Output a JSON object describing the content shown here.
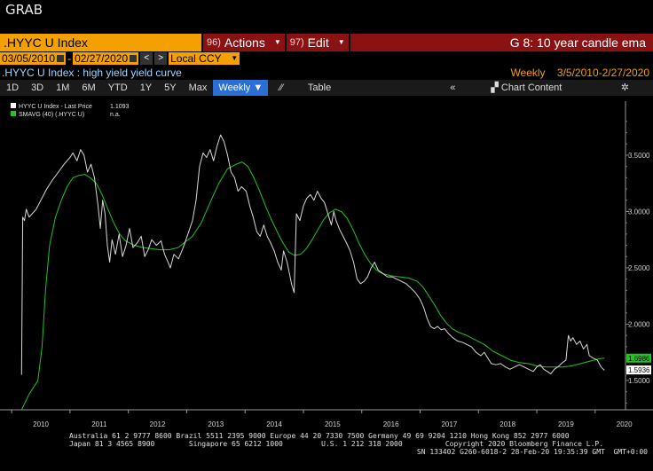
{
  "app": {
    "title": "GRAB"
  },
  "command_bar": {
    "ticker": ".HYYC U Index",
    "actions_num": "96)",
    "actions_label": "Actions",
    "edit_num": "97)",
    "edit_label": "Edit",
    "chart_title": "G 8: 10 year candle ema"
  },
  "date_range": {
    "start": "03/05/2010",
    "end": "02/27/2020",
    "currency": "Local CCY"
  },
  "header": {
    "subtitle": ".HYYC U Index : high yield yield curve",
    "periodicity": "Weekly",
    "range": "3/5/2010-2/27/2020"
  },
  "toolbar": {
    "periods": [
      "1D",
      "3D",
      "1M",
      "6M",
      "YTD",
      "1Y",
      "5Y",
      "Max"
    ],
    "frequency": "Weekly",
    "table": "Table",
    "chart_content": "Chart Content"
  },
  "legend": {
    "items": [
      {
        "label": "HYYC U Index - Last Price",
        "value": "1.1093",
        "color": "#ffffff"
      },
      {
        "label": "SMAVG (40) (.HYYC U)",
        "value": "n.a.",
        "color": "#22c322"
      }
    ]
  },
  "chart_data": {
    "type": "line",
    "x_labels": [
      "2010",
      "2011",
      "2012",
      "2013",
      "2014",
      "2015",
      "2016",
      "2017",
      "2018",
      "2019",
      "2020"
    ],
    "y_ticks": [
      "3.5000",
      "3.0000",
      "2.5000",
      "2.0000",
      "1.5000"
    ],
    "ylim": [
      1.24,
      3.98
    ],
    "grid": false,
    "series": [
      {
        "name": "HYYC U Index - Last Price",
        "color": "#d8d8d8",
        "points": [
          [
            2010.17,
            1.55
          ],
          [
            2010.19,
            2.95
          ],
          [
            2010.22,
            2.92
          ],
          [
            2010.25,
            3.02
          ],
          [
            2010.3,
            2.95
          ],
          [
            2010.35,
            2.98
          ],
          [
            2010.42,
            3.02
          ],
          [
            2010.5,
            3.1
          ],
          [
            2010.6,
            3.2
          ],
          [
            2010.7,
            3.28
          ],
          [
            2010.8,
            3.35
          ],
          [
            2010.9,
            3.42
          ],
          [
            2011.0,
            3.48
          ],
          [
            2011.05,
            3.52
          ],
          [
            2011.12,
            3.45
          ],
          [
            2011.18,
            3.55
          ],
          [
            2011.24,
            3.5
          ],
          [
            2011.3,
            3.35
          ],
          [
            2011.36,
            3.42
          ],
          [
            2011.42,
            3.3
          ],
          [
            2011.48,
            3.05
          ],
          [
            2011.52,
            2.85
          ],
          [
            2011.56,
            3.1
          ],
          [
            2011.6,
            2.98
          ],
          [
            2011.64,
            2.7
          ],
          [
            2011.68,
            2.55
          ],
          [
            2011.72,
            2.75
          ],
          [
            2011.78,
            2.62
          ],
          [
            2011.84,
            2.8
          ],
          [
            2011.9,
            2.6
          ],
          [
            2011.96,
            2.7
          ],
          [
            2012.02,
            2.85
          ],
          [
            2012.08,
            2.68
          ],
          [
            2012.15,
            2.72
          ],
          [
            2012.22,
            2.78
          ],
          [
            2012.28,
            2.6
          ],
          [
            2012.34,
            2.66
          ],
          [
            2012.4,
            2.75
          ],
          [
            2012.48,
            2.7
          ],
          [
            2012.56,
            2.74
          ],
          [
            2012.62,
            2.62
          ],
          [
            2012.68,
            2.55
          ],
          [
            2012.72,
            2.5
          ],
          [
            2012.78,
            2.62
          ],
          [
            2012.86,
            2.58
          ],
          [
            2012.94,
            2.68
          ],
          [
            2013.02,
            2.8
          ],
          [
            2013.1,
            2.92
          ],
          [
            2013.16,
            3.1
          ],
          [
            2013.22,
            3.4
          ],
          [
            2013.28,
            3.52
          ],
          [
            2013.34,
            3.48
          ],
          [
            2013.4,
            3.55
          ],
          [
            2013.46,
            3.45
          ],
          [
            2013.52,
            3.58
          ],
          [
            2013.58,
            3.68
          ],
          [
            2013.64,
            3.62
          ],
          [
            2013.7,
            3.5
          ],
          [
            2013.76,
            3.35
          ],
          [
            2013.82,
            3.3
          ],
          [
            2013.88,
            3.18
          ],
          [
            2013.94,
            3.22
          ],
          [
            2014.02,
            3.18
          ],
          [
            2014.08,
            3.05
          ],
          [
            2014.14,
            2.95
          ],
          [
            2014.2,
            2.82
          ],
          [
            2014.26,
            2.78
          ],
          [
            2014.32,
            2.88
          ],
          [
            2014.38,
            2.78
          ],
          [
            2014.44,
            2.72
          ],
          [
            2014.5,
            2.65
          ],
          [
            2014.56,
            2.55
          ],
          [
            2014.62,
            2.48
          ],
          [
            2014.66,
            2.65
          ],
          [
            2014.72,
            2.55
          ],
          [
            2014.76,
            2.45
          ],
          [
            2014.8,
            2.35
          ],
          [
            2014.84,
            2.28
          ],
          [
            2014.88,
            2.98
          ],
          [
            2014.94,
            2.92
          ],
          [
            2015.0,
            3.05
          ],
          [
            2015.06,
            3.12
          ],
          [
            2015.12,
            3.15
          ],
          [
            2015.18,
            3.1
          ],
          [
            2015.24,
            3.18
          ],
          [
            2015.3,
            3.12
          ],
          [
            2015.36,
            3.08
          ],
          [
            2015.42,
            2.98
          ],
          [
            2015.48,
            2.88
          ],
          [
            2015.52,
            3.0
          ],
          [
            2015.56,
            2.92
          ],
          [
            2015.62,
            2.84
          ],
          [
            2015.68,
            2.78
          ],
          [
            2015.74,
            2.72
          ],
          [
            2015.8,
            2.65
          ],
          [
            2015.86,
            2.55
          ],
          [
            2015.92,
            2.4
          ],
          [
            2015.98,
            2.36
          ],
          [
            2016.04,
            2.38
          ],
          [
            2016.1,
            2.42
          ],
          [
            2016.16,
            2.5
          ],
          [
            2016.22,
            2.55
          ],
          [
            2016.28,
            2.48
          ],
          [
            2016.36,
            2.45
          ],
          [
            2016.44,
            2.42
          ],
          [
            2016.52,
            2.42
          ],
          [
            2016.6,
            2.4
          ],
          [
            2016.68,
            2.38
          ],
          [
            2016.76,
            2.36
          ],
          [
            2016.84,
            2.32
          ],
          [
            2016.92,
            2.28
          ],
          [
            2017.0,
            2.22
          ],
          [
            2017.06,
            2.15
          ],
          [
            2017.12,
            2.05
          ],
          [
            2017.18,
            1.98
          ],
          [
            2017.24,
            1.96
          ],
          [
            2017.3,
            1.98
          ],
          [
            2017.36,
            1.95
          ],
          [
            2017.42,
            1.96
          ],
          [
            2017.48,
            1.92
          ],
          [
            2017.56,
            1.88
          ],
          [
            2017.64,
            1.85
          ],
          [
            2017.72,
            1.84
          ],
          [
            2017.8,
            1.82
          ],
          [
            2017.88,
            1.8
          ],
          [
            2017.96,
            1.75
          ],
          [
            2018.04,
            1.72
          ],
          [
            2018.1,
            1.75
          ],
          [
            2018.16,
            1.7
          ],
          [
            2018.22,
            1.65
          ],
          [
            2018.3,
            1.64
          ],
          [
            2018.38,
            1.65
          ],
          [
            2018.46,
            1.62
          ],
          [
            2018.54,
            1.6
          ],
          [
            2018.62,
            1.62
          ],
          [
            2018.7,
            1.64
          ],
          [
            2018.78,
            1.62
          ],
          [
            2018.86,
            1.6
          ],
          [
            2018.94,
            1.58
          ],
          [
            2019.0,
            1.62
          ],
          [
            2019.06,
            1.64
          ],
          [
            2019.12,
            1.6
          ],
          [
            2019.18,
            1.58
          ],
          [
            2019.24,
            1.56
          ],
          [
            2019.3,
            1.6
          ],
          [
            2019.36,
            1.62
          ],
          [
            2019.44,
            1.66
          ],
          [
            2019.5,
            1.68
          ],
          [
            2019.54,
            1.9
          ],
          [
            2019.58,
            1.85
          ],
          [
            2019.62,
            1.88
          ],
          [
            2019.68,
            1.82
          ],
          [
            2019.74,
            1.85
          ],
          [
            2019.8,
            1.78
          ],
          [
            2019.86,
            1.82
          ],
          [
            2019.9,
            1.72
          ],
          [
            2019.96,
            1.7
          ],
          [
            2020.04,
            1.68
          ],
          [
            2020.1,
            1.62
          ],
          [
            2020.16,
            1.59
          ]
        ]
      },
      {
        "name": "SMAVG (40) (.HYYC U)",
        "color": "#22c322",
        "points": [
          [
            2010.17,
            1.24
          ],
          [
            2010.3,
            1.38
          ],
          [
            2010.45,
            1.5
          ],
          [
            2010.52,
            1.8
          ],
          [
            2010.58,
            2.3
          ],
          [
            2010.65,
            2.7
          ],
          [
            2010.75,
            2.95
          ],
          [
            2010.85,
            3.1
          ],
          [
            2010.95,
            3.22
          ],
          [
            2011.05,
            3.3
          ],
          [
            2011.15,
            3.32
          ],
          [
            2011.25,
            3.33
          ],
          [
            2011.35,
            3.3
          ],
          [
            2011.45,
            3.25
          ],
          [
            2011.55,
            3.15
          ],
          [
            2011.65,
            3.02
          ],
          [
            2011.75,
            2.9
          ],
          [
            2011.85,
            2.8
          ],
          [
            2011.95,
            2.74
          ],
          [
            2012.1,
            2.7
          ],
          [
            2012.25,
            2.68
          ],
          [
            2012.4,
            2.67
          ],
          [
            2012.55,
            2.66
          ],
          [
            2012.7,
            2.66
          ],
          [
            2012.85,
            2.68
          ],
          [
            2012.95,
            2.72
          ],
          [
            2013.1,
            2.78
          ],
          [
            2013.25,
            2.9
          ],
          [
            2013.4,
            3.08
          ],
          [
            2013.55,
            3.25
          ],
          [
            2013.7,
            3.38
          ],
          [
            2013.85,
            3.42
          ],
          [
            2013.95,
            3.44
          ],
          [
            2014.05,
            3.4
          ],
          [
            2014.15,
            3.3
          ],
          [
            2014.25,
            3.18
          ],
          [
            2014.35,
            3.05
          ],
          [
            2014.45,
            2.93
          ],
          [
            2014.55,
            2.82
          ],
          [
            2014.65,
            2.72
          ],
          [
            2014.75,
            2.64
          ],
          [
            2014.85,
            2.61
          ],
          [
            2014.95,
            2.62
          ],
          [
            2015.05,
            2.67
          ],
          [
            2015.15,
            2.75
          ],
          [
            2015.25,
            2.84
          ],
          [
            2015.35,
            2.93
          ],
          [
            2015.45,
            2.99
          ],
          [
            2015.55,
            3.02
          ],
          [
            2015.65,
            3.0
          ],
          [
            2015.75,
            2.94
          ],
          [
            2015.85,
            2.84
          ],
          [
            2015.95,
            2.72
          ],
          [
            2016.05,
            2.62
          ],
          [
            2016.15,
            2.54
          ],
          [
            2016.25,
            2.48
          ],
          [
            2016.35,
            2.45
          ],
          [
            2016.5,
            2.43
          ],
          [
            2016.65,
            2.42
          ],
          [
            2016.8,
            2.41
          ],
          [
            2016.95,
            2.38
          ],
          [
            2017.05,
            2.33
          ],
          [
            2017.15,
            2.25
          ],
          [
            2017.25,
            2.17
          ],
          [
            2017.35,
            2.08
          ],
          [
            2017.45,
            2.01
          ],
          [
            2017.55,
            1.96
          ],
          [
            2017.65,
            1.93
          ],
          [
            2017.8,
            1.9
          ],
          [
            2017.95,
            1.86
          ],
          [
            2018.1,
            1.82
          ],
          [
            2018.25,
            1.76
          ],
          [
            2018.4,
            1.72
          ],
          [
            2018.55,
            1.68
          ],
          [
            2018.7,
            1.66
          ],
          [
            2018.85,
            1.65
          ],
          [
            2019.0,
            1.63
          ],
          [
            2019.15,
            1.62
          ],
          [
            2019.3,
            1.62
          ],
          [
            2019.45,
            1.62
          ],
          [
            2019.6,
            1.63
          ],
          [
            2019.75,
            1.65
          ],
          [
            2019.9,
            1.67
          ],
          [
            2020.05,
            1.69
          ],
          [
            2020.16,
            1.7
          ]
        ]
      }
    ],
    "last_value_labels": [
      {
        "text": "1.6986",
        "value": 1.6986,
        "bg": "#22c322",
        "fg": "#000000"
      },
      {
        "text": "1.5936",
        "value": 1.5936,
        "bg": "#ffffff",
        "fg": "#000000"
      }
    ]
  },
  "footer": {
    "line1": "Australia 61 2 9777 8600 Brazil 5511 2395 9000 Europe 44 20 7330 7500 Germany 49 69 9204 1210 Hong Kong 852 2977 6000",
    "line2": "Japan 81 3 4565 8900        Singapore 65 6212 1000         U.S. 1 212 318 2000          Copyright 2020 Bloomberg Finance L.P.",
    "line3": "SN 133402 G260-6018-2 28-Feb-20 19:35:39 GMT  GMT+0:00"
  }
}
